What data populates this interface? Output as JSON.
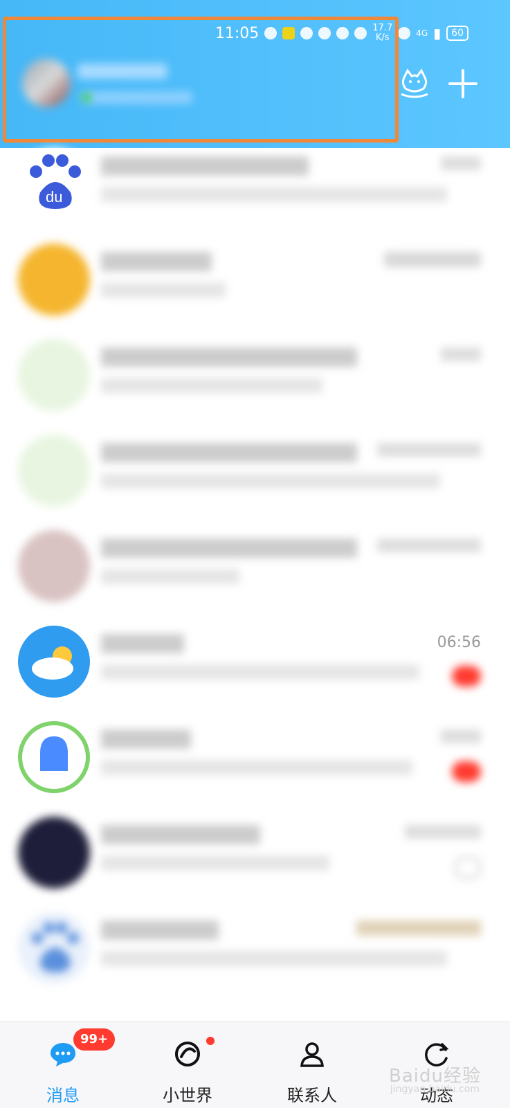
{
  "status_bar": {
    "time": "11:05",
    "speed": "17.7",
    "speed_unit": "K/s",
    "network": "4G",
    "battery": "60"
  },
  "header": {
    "profile_name": "",
    "profile_status": "",
    "actions": [
      "cat-mascot-icon",
      "plus-icon"
    ]
  },
  "conversations": [
    {
      "title": "",
      "message": "",
      "time": "",
      "badge": "",
      "avatar_color": "#3b5bdb",
      "avatar_text": "du"
    },
    {
      "title": "",
      "message": "",
      "time": "",
      "badge": "",
      "avatar_color": "#f5b52e"
    },
    {
      "title": "",
      "message": "",
      "time": "",
      "badge": "",
      "avatar_color": "#dff2d5"
    },
    {
      "title": "",
      "message": "",
      "time": "",
      "badge": "",
      "avatar_color": "#dff2d5"
    },
    {
      "title": "",
      "message": "",
      "time": "",
      "badge": "",
      "avatar_color": "#d9c7c7"
    },
    {
      "title": "",
      "message": "",
      "time": "06:56",
      "badge": "",
      "avatar_color": "#2f9cf0"
    },
    {
      "title": "",
      "message": "",
      "time": "",
      "badge": "",
      "avatar_color": "#4a8cff"
    },
    {
      "title": "",
      "message": "",
      "time": "",
      "badge": "",
      "avatar_color": "#1e1e3a"
    },
    {
      "title": "",
      "message": "",
      "time": "",
      "badge": "",
      "avatar_color": "#5a8fdc"
    }
  ],
  "tabbar": {
    "messages_label": "消息",
    "messages_badge": "99+",
    "world_label": "小世界",
    "contacts_label": "联系人",
    "moments_label": "动态"
  },
  "watermark": {
    "text": "Baidu经验",
    "sub": "jingyan.baidu.com"
  }
}
